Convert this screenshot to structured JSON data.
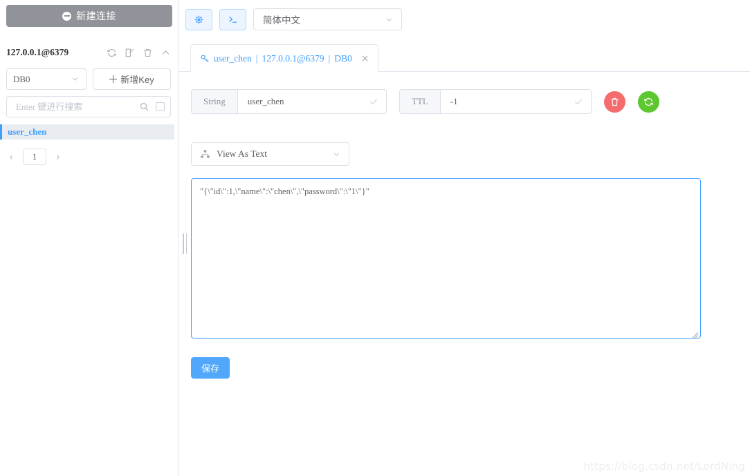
{
  "sidebar": {
    "new_connection_label": "新建连接",
    "connection_name": "127.0.0.1@6379",
    "icons": {
      "refresh": "refresh-icon",
      "edit": "edit-icon",
      "delete": "delete-icon",
      "collapse": "chevron-up-icon"
    },
    "db_selected": "DB0",
    "add_key_label": "新增Key",
    "search_placeholder": "Enter 键进行搜索",
    "search_value": "",
    "keys": [
      {
        "name": "user_chen",
        "selected": true
      }
    ],
    "pagination": {
      "prev": "‹",
      "page": "1",
      "next": "›"
    }
  },
  "topbar": {
    "settings_button": "settings-icon",
    "console_button": "console-icon",
    "language_selected": "简体中文"
  },
  "tabs": [
    {
      "key_name": "user_chen",
      "separator_1": "|",
      "host": "127.0.0.1@6379",
      "separator_2": "|",
      "db": "DB0",
      "close": "×",
      "active": true
    }
  ],
  "editor": {
    "key_type_label": "String",
    "key_name_value": "user_chen",
    "ttl_label": "TTL",
    "ttl_value": "-1",
    "delete_button": "delete-key-button",
    "refresh_button": "refresh-key-button",
    "view_as_label": "View As Text",
    "content_value": "\"{\\\"id\\\":1,\\\"name\\\":\\\"chen\\\",\\\"password\\\":\\\"1\\\"}\"",
    "save_label": "保存"
  },
  "watermark": "https://blog.csdn.net/LordNing",
  "colors": {
    "primary": "#409eff",
    "save_button": "#51a7f9",
    "new_connection": "#909399",
    "danger": "#f56c6c",
    "success": "#5cc72f",
    "border": "#dcdfe6",
    "text": "#606266"
  }
}
